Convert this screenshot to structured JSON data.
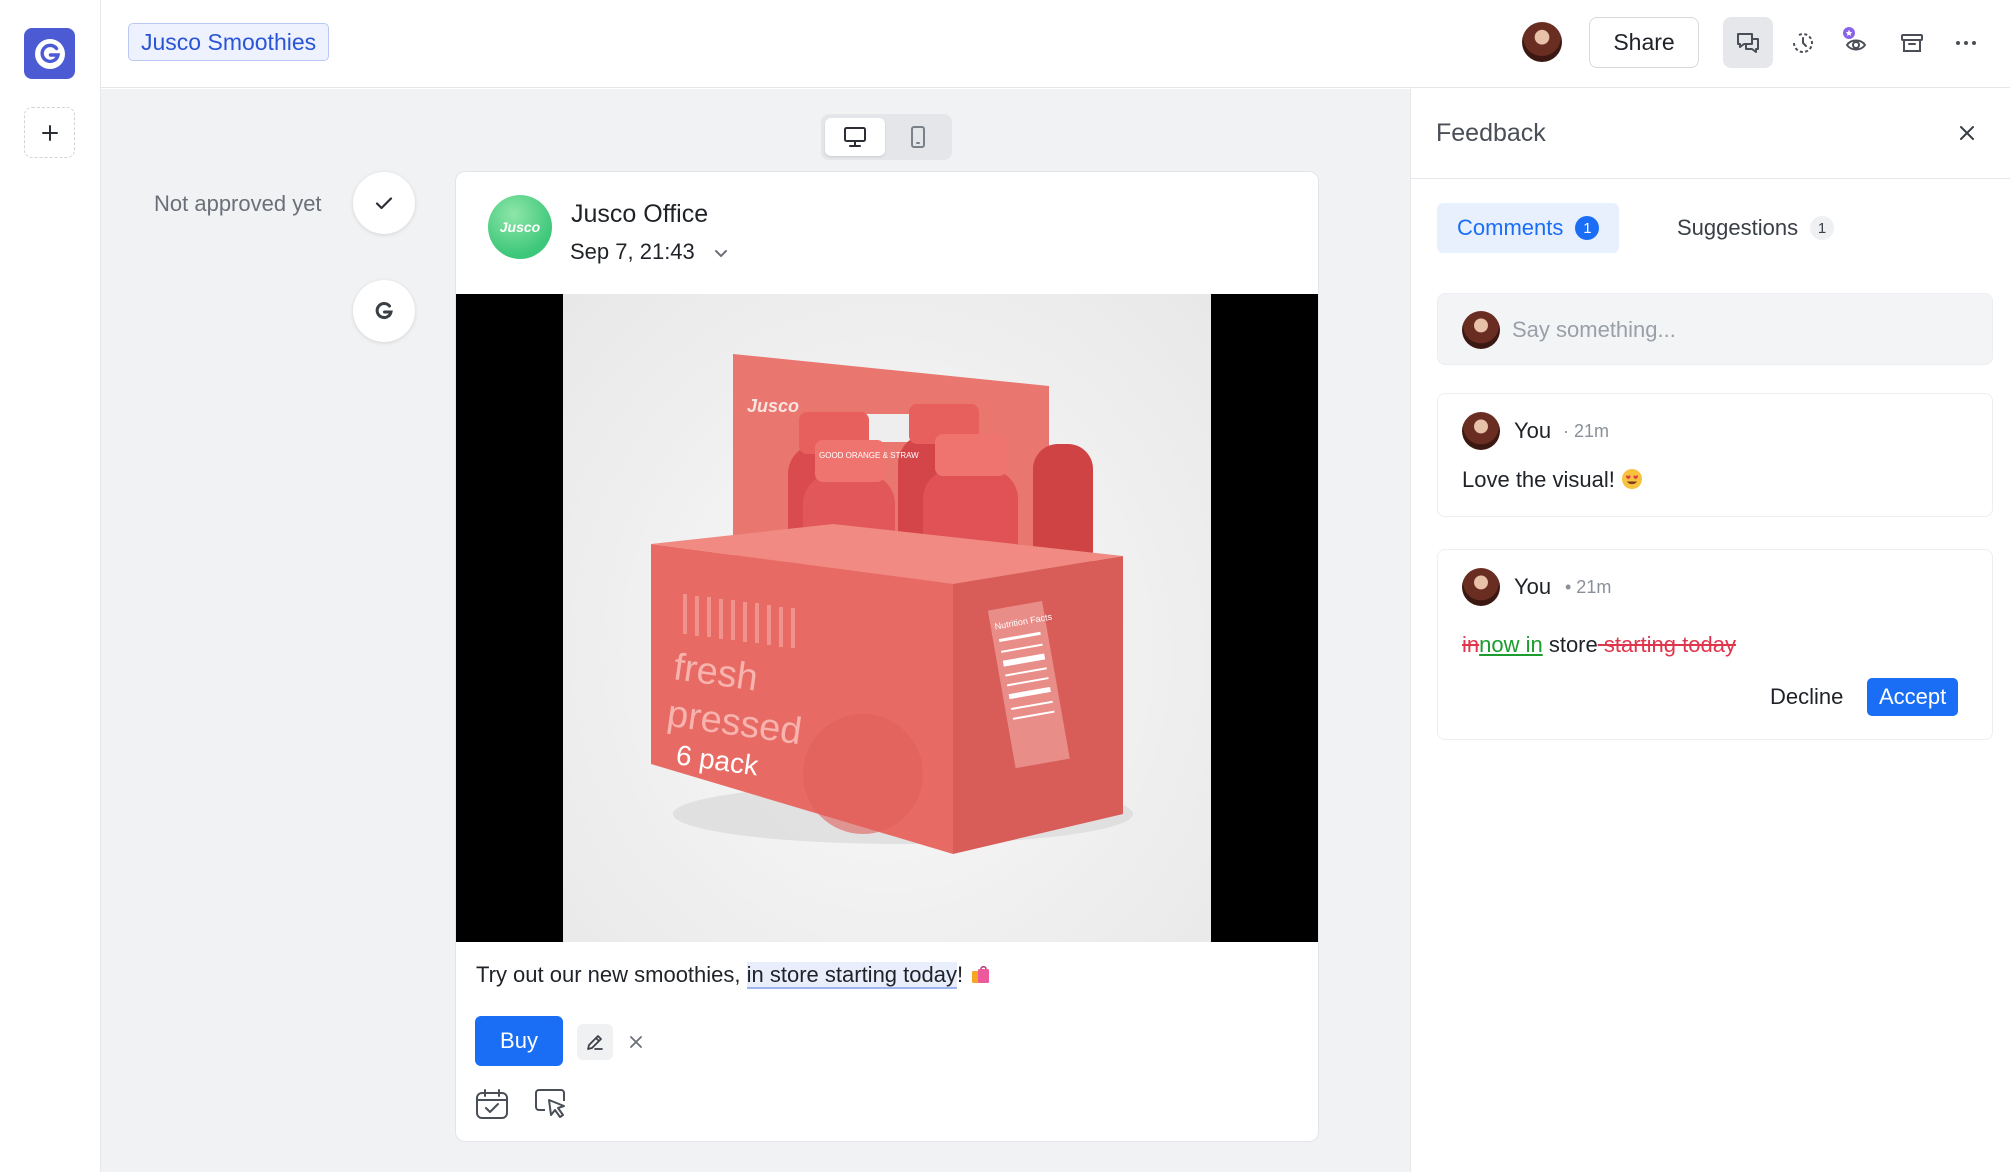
{
  "header": {
    "project_tag": "Jusco Smoothies",
    "share_label": "Share"
  },
  "preview": {
    "approval_status": "Not approved yet",
    "post": {
      "account_name": "Jusco Office",
      "account_avatar_text": "Jusco",
      "scheduled_date": "Sep 7, 21:43",
      "caption_prefix": "Try out our new smoothies, ",
      "caption_highlight": "in store starting today",
      "caption_suffix": "! ",
      "cta_label": "Buy",
      "image": {
        "brand_text": "Jusco",
        "box_line1": "fresh",
        "box_line2": "pressed",
        "box_line3": "6 pack",
        "cap_label": "GOOD ORANGE & STRAW",
        "side_label": "Nutrition Facts"
      }
    }
  },
  "feedback": {
    "title": "Feedback",
    "tabs": [
      {
        "label": "Comments",
        "count": "1"
      },
      {
        "label": "Suggestions",
        "count": "1"
      }
    ],
    "input_placeholder": "Say something...",
    "comments": [
      {
        "author": "You",
        "time": "· 21m",
        "text": "Love the visual! "
      },
      {
        "author": "You",
        "time": "• 21m",
        "suggestion": {
          "deleted_1": "in",
          "inserted": "now in",
          "kept": " store",
          "deleted_2": " starting today"
        },
        "decline_label": "Decline",
        "accept_label": "Accept"
      }
    ]
  },
  "colors": {
    "accent": "#1a6ef5",
    "brand_logo": "#4c5bd4",
    "deleted_text": "#e0364d",
    "inserted_text": "#1b9c2e",
    "product_red": "#e86a64"
  },
  "icons": [
    "grammarly-logo-icon",
    "plus-icon",
    "chat-icon",
    "history-icon",
    "eye-icon",
    "archive-icon",
    "more-icon",
    "desktop-icon",
    "mobile-icon",
    "check-icon",
    "chevron-down-icon",
    "pencil-icon",
    "close-icon",
    "calendar-check-icon",
    "pointer-icon"
  ]
}
